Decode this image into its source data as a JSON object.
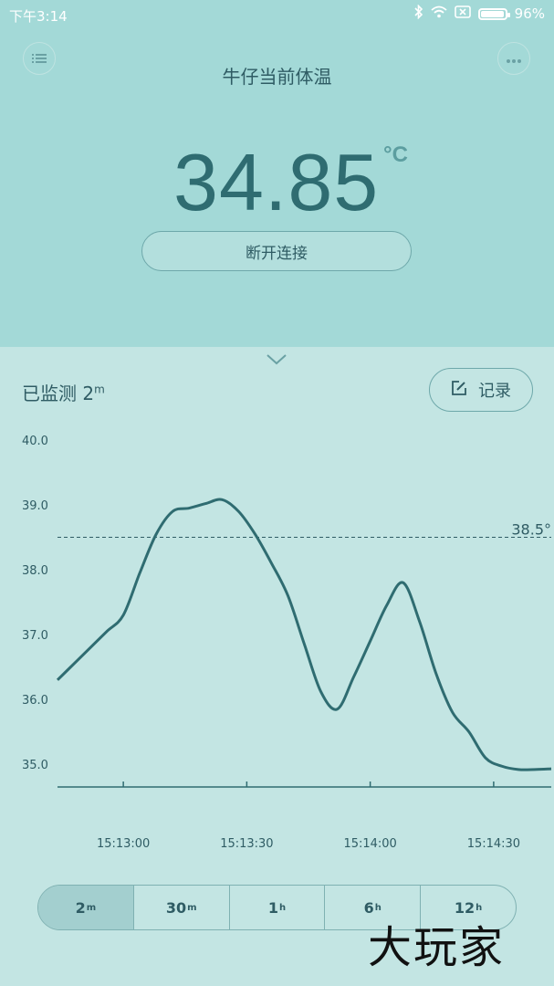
{
  "status_bar": {
    "time": "下午3:14",
    "battery": "96%",
    "battery_level": 0.96
  },
  "header": {
    "title": "牛仔当前体温",
    "temperature": "34.85",
    "unit": "°C",
    "disconnect_label": "断开连接"
  },
  "monitor": {
    "label": "已监测 2",
    "duration_unit": "m",
    "record_label": "记录"
  },
  "chart_data": {
    "type": "line",
    "x_ticks": [
      "15:13:00",
      "15:13:30",
      "15:14:00",
      "15:14:30"
    ],
    "y_ticks": [
      "40.0",
      "39.0",
      "38.0",
      "37.0",
      "36.0",
      "35.0"
    ],
    "ylim": [
      34.65,
      40.0
    ],
    "xlim": [
      "15:12:44",
      "15:14:44"
    ],
    "threshold": {
      "value": 38.5,
      "label": "38.5°"
    },
    "series": [
      {
        "points": [
          [
            "15:12:44",
            36.3
          ],
          [
            "15:12:48",
            36.55
          ],
          [
            "15:12:52",
            36.8
          ],
          [
            "15:12:56",
            37.05
          ],
          [
            "15:13:00",
            37.3
          ],
          [
            "15:13:04",
            37.95
          ],
          [
            "15:13:08",
            38.55
          ],
          [
            "15:13:12",
            38.9
          ],
          [
            "15:13:16",
            38.95
          ],
          [
            "15:13:20",
            39.02
          ],
          [
            "15:13:24",
            39.08
          ],
          [
            "15:13:28",
            38.9
          ],
          [
            "15:13:32",
            38.55
          ],
          [
            "15:13:36",
            38.1
          ],
          [
            "15:13:40",
            37.6
          ],
          [
            "15:13:44",
            36.85
          ],
          [
            "15:13:48",
            36.12
          ],
          [
            "15:13:52",
            35.85
          ],
          [
            "15:13:56",
            36.35
          ],
          [
            "15:14:00",
            36.9
          ],
          [
            "15:14:04",
            37.45
          ],
          [
            "15:14:08",
            37.8
          ],
          [
            "15:14:12",
            37.2
          ],
          [
            "15:14:16",
            36.4
          ],
          [
            "15:14:20",
            35.8
          ],
          [
            "15:14:24",
            35.5
          ],
          [
            "15:14:28",
            35.1
          ],
          [
            "15:14:32",
            34.97
          ],
          [
            "15:14:36",
            34.92
          ],
          [
            "15:14:40",
            34.92
          ],
          [
            "15:14:44",
            34.93
          ]
        ]
      }
    ]
  },
  "range_tabs": [
    {
      "value": "2",
      "unit": "m",
      "active": true
    },
    {
      "value": "30",
      "unit": "m",
      "active": false
    },
    {
      "value": "1",
      "unit": "h",
      "active": false
    },
    {
      "value": "6",
      "unit": "h",
      "active": false
    },
    {
      "value": "12",
      "unit": "h",
      "active": false
    }
  ],
  "watermark": "大玩家",
  "colors": {
    "top_bg": "#a3d9d7",
    "bottom_bg": "#c3e5e3",
    "line": "#2f6c71",
    "text": "#2f5c64"
  }
}
